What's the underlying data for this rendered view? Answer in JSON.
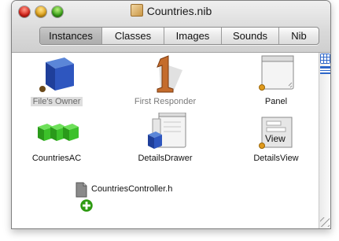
{
  "window": {
    "title": "Countries.nib"
  },
  "tabs": [
    {
      "label": "Instances",
      "selected": true
    },
    {
      "label": "Classes",
      "selected": false
    },
    {
      "label": "Images",
      "selected": false
    },
    {
      "label": "Sounds",
      "selected": false
    },
    {
      "label": "Nib",
      "selected": false
    }
  ],
  "items": [
    {
      "label": "File's Owner",
      "icon": "blue-cube-icon"
    },
    {
      "label": "First Responder",
      "icon": "number-one-icon"
    },
    {
      "label": "Panel",
      "icon": "panel-window-icon"
    },
    {
      "label": "CountriesAC",
      "icon": "array-controller-icon"
    },
    {
      "label": "DetailsDrawer",
      "icon": "drawer-icon"
    },
    {
      "label": "DetailsView",
      "icon": "view-icon",
      "icon_text": "View"
    }
  ],
  "dragged_file": {
    "label": "CountriesController.h",
    "icon": "header-file-icon",
    "badge": "add-plus-icon"
  },
  "colors": {
    "accent": "#2e66c8",
    "selection_gray": "#dedede",
    "badge_orange": "#d98a14",
    "plus_green": "#2e9a12"
  }
}
